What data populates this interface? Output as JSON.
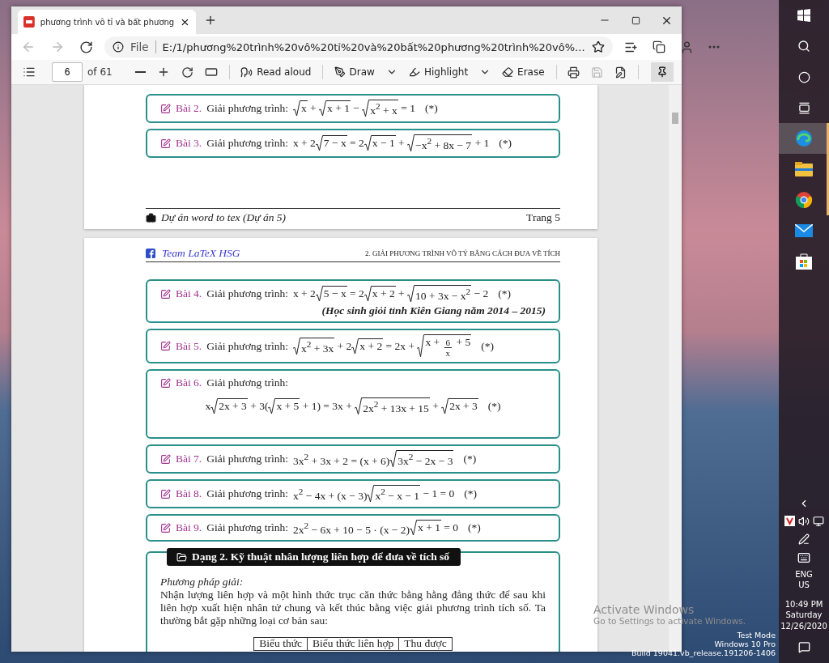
{
  "browser": {
    "tab": {
      "title": "phương trình vô tỉ và bất phương",
      "selected": true
    },
    "address": {
      "scheme": "File",
      "url": "E:/1/phương%20trình%20vô%20tỉ%20và%20bất%20phương%20trình%20vô%..."
    },
    "pdf_toolbar": {
      "page_number": "6",
      "page_total": "of 61",
      "read_aloud": "Read aloud",
      "draw": "Draw",
      "highlight": "Highlight",
      "erase": "Erase",
      "pinned": true
    }
  },
  "pages": [
    {
      "problems": [
        {
          "kind": "inline",
          "label": "Bài 2.",
          "lead": "Giải phương trình:",
          "mark": "(*)",
          "formula": [
            {
              "kind": "root",
              "text": "x"
            },
            {
              "kind": "text",
              "text": " + "
            },
            {
              "kind": "root",
              "text": "x + 1"
            },
            {
              "kind": "text",
              "text": " − "
            },
            {
              "kind": "root",
              "text": "x$^{2}$ + x"
            },
            {
              "kind": "text",
              "text": " = 1"
            }
          ]
        },
        {
          "kind": "inline",
          "label": "Bài 3.",
          "lead": "Giải phương trình:",
          "mark": "(*)",
          "formula": [
            {
              "kind": "text",
              "text": "x + 2"
            },
            {
              "kind": "root",
              "text": "7 − x"
            },
            {
              "kind": "text",
              "text": " = 2"
            },
            {
              "kind": "root",
              "text": "x − 1"
            },
            {
              "kind": "text",
              "text": " + "
            },
            {
              "kind": "root",
              "text": "−x$^{2}$ + 8x − 7"
            },
            {
              "kind": "text",
              "text": " + 1"
            }
          ]
        }
      ],
      "footer": {
        "left": "Dự án word to tex (Dự án 5)",
        "right": "Trang 5"
      }
    },
    {
      "header": {
        "left": "Team LaTeX HSG",
        "right": "2. GIẢI PHƯƠNG TRÌNH VÔ TỶ BẰNG CÁCH ĐƯA VỀ TÍCH"
      },
      "problems": [
        {
          "kind": "inline",
          "label": "Bài 4.",
          "lead": "Giải phương trình:",
          "mark": "(*)",
          "note": "(Học sinh giỏi tỉnh Kiên Giang năm 2014 – 2015)",
          "formula": [
            {
              "kind": "text",
              "text": "x + 2"
            },
            {
              "kind": "root",
              "text": "5 − x"
            },
            {
              "kind": "text",
              "text": " = 2"
            },
            {
              "kind": "root",
              "text": "x + 2"
            },
            {
              "kind": "text",
              "text": " + "
            },
            {
              "kind": "root",
              "text": "10 + 3x − x$^{2}$"
            },
            {
              "kind": "text",
              "text": " − 2"
            }
          ]
        },
        {
          "kind": "inline",
          "label": "Bài 5.",
          "lead": "Giải phương trình:",
          "mark": "(*)",
          "formula": [
            {
              "kind": "root",
              "text": "x$^{2}$ + 3x"
            },
            {
              "kind": "text",
              "text": " + 2"
            },
            {
              "kind": "root",
              "text": "x + 2"
            },
            {
              "kind": "text",
              "text": " = 2x + "
            },
            {
              "kind": "root",
              "parts": [
                {
                  "kind": "text",
                  "text": "x + "
                },
                {
                  "kind": "frac",
                  "num": "6",
                  "den": "x"
                },
                {
                  "kind": "text",
                  "text": " + 5"
                }
              ]
            }
          ]
        },
        {
          "kind": "display",
          "label": "Bài 6.",
          "lead": "Giải phương trình:",
          "mark": "(*)",
          "formula": [
            {
              "kind": "text",
              "text": "x"
            },
            {
              "kind": "root",
              "text": "2x + 3"
            },
            {
              "kind": "text",
              "text": " + 3("
            },
            {
              "kind": "root",
              "text": "x + 5"
            },
            {
              "kind": "text",
              "text": " + 1) = 3x + "
            },
            {
              "kind": "root",
              "text": "2x$^{2}$ + 13x + 15"
            },
            {
              "kind": "text",
              "text": " + "
            },
            {
              "kind": "root",
              "text": "2x + 3"
            }
          ]
        },
        {
          "kind": "inline",
          "label": "Bài 7.",
          "lead": "Giải phương trình:",
          "mark": "(*)",
          "formula": [
            {
              "kind": "text",
              "text": "3x$^{2}$ + 3x + 2 = (x + 6)"
            },
            {
              "kind": "root",
              "text": "3x$^{2}$ − 2x − 3"
            }
          ]
        },
        {
          "kind": "inline",
          "label": "Bài 8.",
          "lead": "Giải phương trình:",
          "mark": "(*)",
          "formula": [
            {
              "kind": "text",
              "text": "x$^{2}$ − 4x + (x − 3)"
            },
            {
              "kind": "root",
              "text": "x$^{2}$ − x − 1"
            },
            {
              "kind": "text",
              "text": " − 1 = 0"
            }
          ]
        },
        {
          "kind": "inline",
          "label": "Bài 9.",
          "lead": "Giải phương trình:",
          "mark": "(*)",
          "formula": [
            {
              "kind": "text",
              "text": "2x$^{2}$ − 6x + 10 − 5 · (x − 2)"
            },
            {
              "kind": "root",
              "text": "x + 1"
            },
            {
              "kind": "text",
              "text": " = 0"
            }
          ]
        }
      ],
      "section": {
        "title": "Dạng 2. Kỹ thuật nhân lượng liên hợp để đưa về tích số",
        "method_label": "Phương pháp giải:",
        "paragraph": "Nhận lượng liên hợp và một hình thức trục căn thức bằng hằng đẳng thức để sau khi liên hợp xuất hiện nhân tử chung và kết thúc bằng việc giải phương trình tích số. Ta thường bắt gặp những loại cơ bản sau:",
        "table_columns": [
          "Biểu thức",
          "Biểu thức liên hợp",
          "Thu được"
        ]
      }
    }
  ],
  "desktop": {
    "activation_title": "Activate Windows",
    "activation_hint": "Go to Settings to activate Windows.",
    "mode": "Test Mode",
    "edition": "Windows 10 Pro",
    "build": "Build 19041.vb_release.191206-1406"
  },
  "taskbar": {
    "apps": [
      {
        "kind": "edge",
        "selected": true,
        "running": true
      },
      {
        "kind": "explorer",
        "selected": false,
        "running": true
      },
      {
        "kind": "chrome",
        "selected": false,
        "running": true
      },
      {
        "kind": "mail",
        "selected": false,
        "running": false
      },
      {
        "kind": "store",
        "selected": false,
        "running": false
      }
    ],
    "language": "ENG",
    "region": "US",
    "time": "10:49 PM",
    "day": "Saturday",
    "date": "12/26/2020"
  }
}
